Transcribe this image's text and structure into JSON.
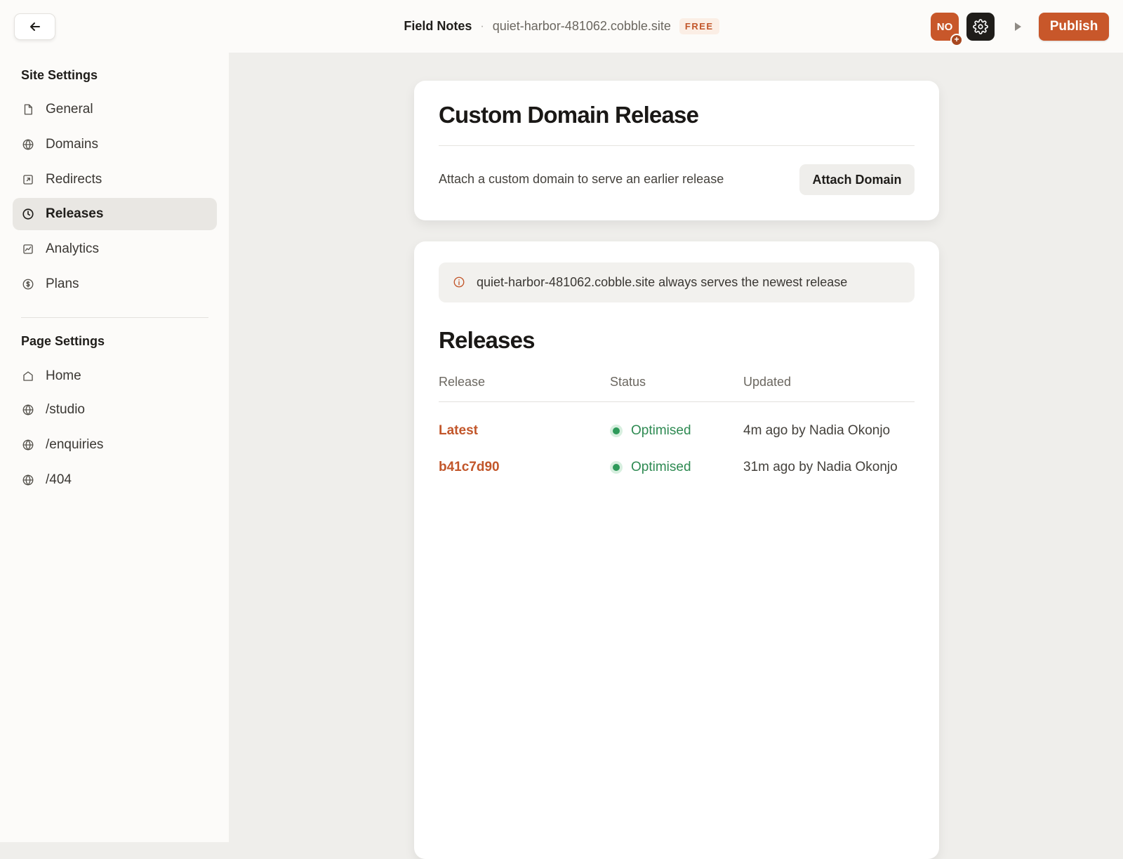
{
  "header": {
    "site_name": "Field Notes",
    "separator": "·",
    "site_url": "quiet-harbor-481062.cobble.site",
    "plan_badge": "FREE",
    "avatar_initials": "NO",
    "avatar_badge": "+",
    "publish_label": "Publish",
    "icons": {
      "back": "arrow-left-icon",
      "settings": "gear-icon",
      "preview": "play-icon"
    }
  },
  "sidebar": {
    "site_settings_title": "Site Settings",
    "site_items": [
      {
        "label": "General",
        "icon": "document-icon",
        "active": false
      },
      {
        "label": "Domains",
        "icon": "globe-icon",
        "active": false
      },
      {
        "label": "Redirects",
        "icon": "redirect-icon",
        "active": false
      },
      {
        "label": "Releases",
        "icon": "clock-icon",
        "active": true
      },
      {
        "label": "Analytics",
        "icon": "chart-icon",
        "active": false
      },
      {
        "label": "Plans",
        "icon": "dollar-icon",
        "active": false
      }
    ],
    "page_settings_title": "Page Settings",
    "page_items": [
      {
        "label": "Home",
        "icon": "home-icon"
      },
      {
        "label": "/studio",
        "icon": "globe-icon"
      },
      {
        "label": "/enquiries",
        "icon": "globe-icon"
      },
      {
        "label": "/404",
        "icon": "globe-icon"
      }
    ]
  },
  "custom_domain_card": {
    "title": "Custom Domain Release",
    "description": "Attach a custom domain to serve an earlier release",
    "attach_button": "Attach Domain"
  },
  "releases_card": {
    "info_text": "quiet-harbor-481062.cobble.site always serves the newest release",
    "heading": "Releases",
    "columns": [
      "Release",
      "Status",
      "Updated"
    ],
    "rows": [
      {
        "release": "Latest",
        "status": "Optimised",
        "updated": "4m ago by Nadia Okonjo"
      },
      {
        "release": "b41c7d90",
        "status": "Optimised",
        "updated": "31m ago by Nadia Okonjo"
      }
    ]
  },
  "colors": {
    "accent": "#c8572a",
    "success": "#2e8a52",
    "sidebar_bg": "#fcfbf9",
    "canvas_bg": "#efeeeb"
  }
}
